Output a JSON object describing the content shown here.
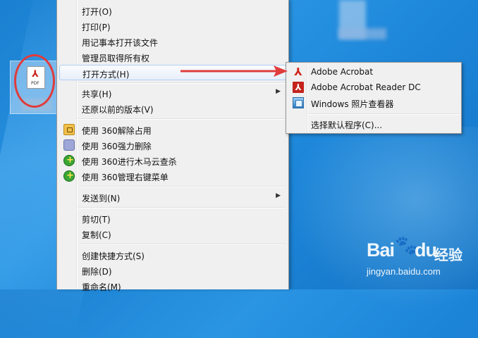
{
  "context_menu": {
    "items": [
      {
        "label": "打开(O)"
      },
      {
        "label": "打印(P)"
      },
      {
        "label": "用记事本打开该文件"
      },
      {
        "label": "管理员取得所有权"
      },
      {
        "label": "打开方式(H)",
        "has_submenu": true,
        "highlighted": true
      },
      {
        "label": "共享(H)",
        "has_submenu": true
      },
      {
        "label": "还原以前的版本(V)"
      },
      {
        "label": "使用 360解除占用",
        "icon": "unlock-icon"
      },
      {
        "label": "使用 360强力删除",
        "icon": "shredder-icon"
      },
      {
        "label": "使用 360进行木马云查杀",
        "icon": "360-guard-icon"
      },
      {
        "label": "使用 360管理右键菜单",
        "icon": "360-guard-icon"
      },
      {
        "label": "发送到(N)",
        "has_submenu": true
      },
      {
        "label": "剪切(T)"
      },
      {
        "label": "复制(C)"
      },
      {
        "label": "创建快捷方式(S)"
      },
      {
        "label": "删除(D)"
      },
      {
        "label": "重命名(M)"
      }
    ]
  },
  "open_with_submenu": {
    "items": [
      {
        "label": "Adobe Acrobat",
        "icon": "adobe-acrobat-icon"
      },
      {
        "label": "Adobe Acrobat Reader DC",
        "icon": "acrobat-reader-dc-icon"
      },
      {
        "label": "Windows 照片查看器",
        "icon": "photo-viewer-icon"
      },
      {
        "label": "选择默认程序(C)..."
      }
    ]
  },
  "desktop_icon": {
    "file_type_text": "PDF"
  },
  "watermark": {
    "brand": "Bai",
    "brand_suffix": "du",
    "product": "经验",
    "url": "jingyan.baidu.com"
  },
  "colors": {
    "annotation_red": "#e03c3c",
    "highlight_border": "#aecff7",
    "desktop_blue": "#1d86d9"
  }
}
